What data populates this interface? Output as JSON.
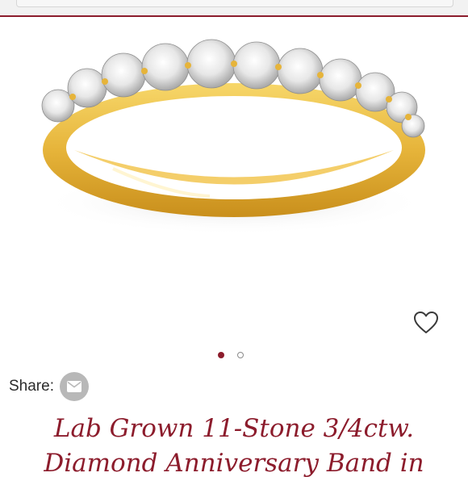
{
  "gallery": {
    "image_subject": "ring-image",
    "active_slide": 1,
    "total_slides": 2
  },
  "share": {
    "label": "Share:",
    "email_icon": "envelope-icon"
  },
  "product": {
    "title": "Lab Grown 11-Stone 3/4ctw. Diamond Anniversary Band in"
  },
  "colors": {
    "accent": "#8c1c2c",
    "gold": "#e8b83a",
    "icon_gray": "#b8b8b8"
  }
}
